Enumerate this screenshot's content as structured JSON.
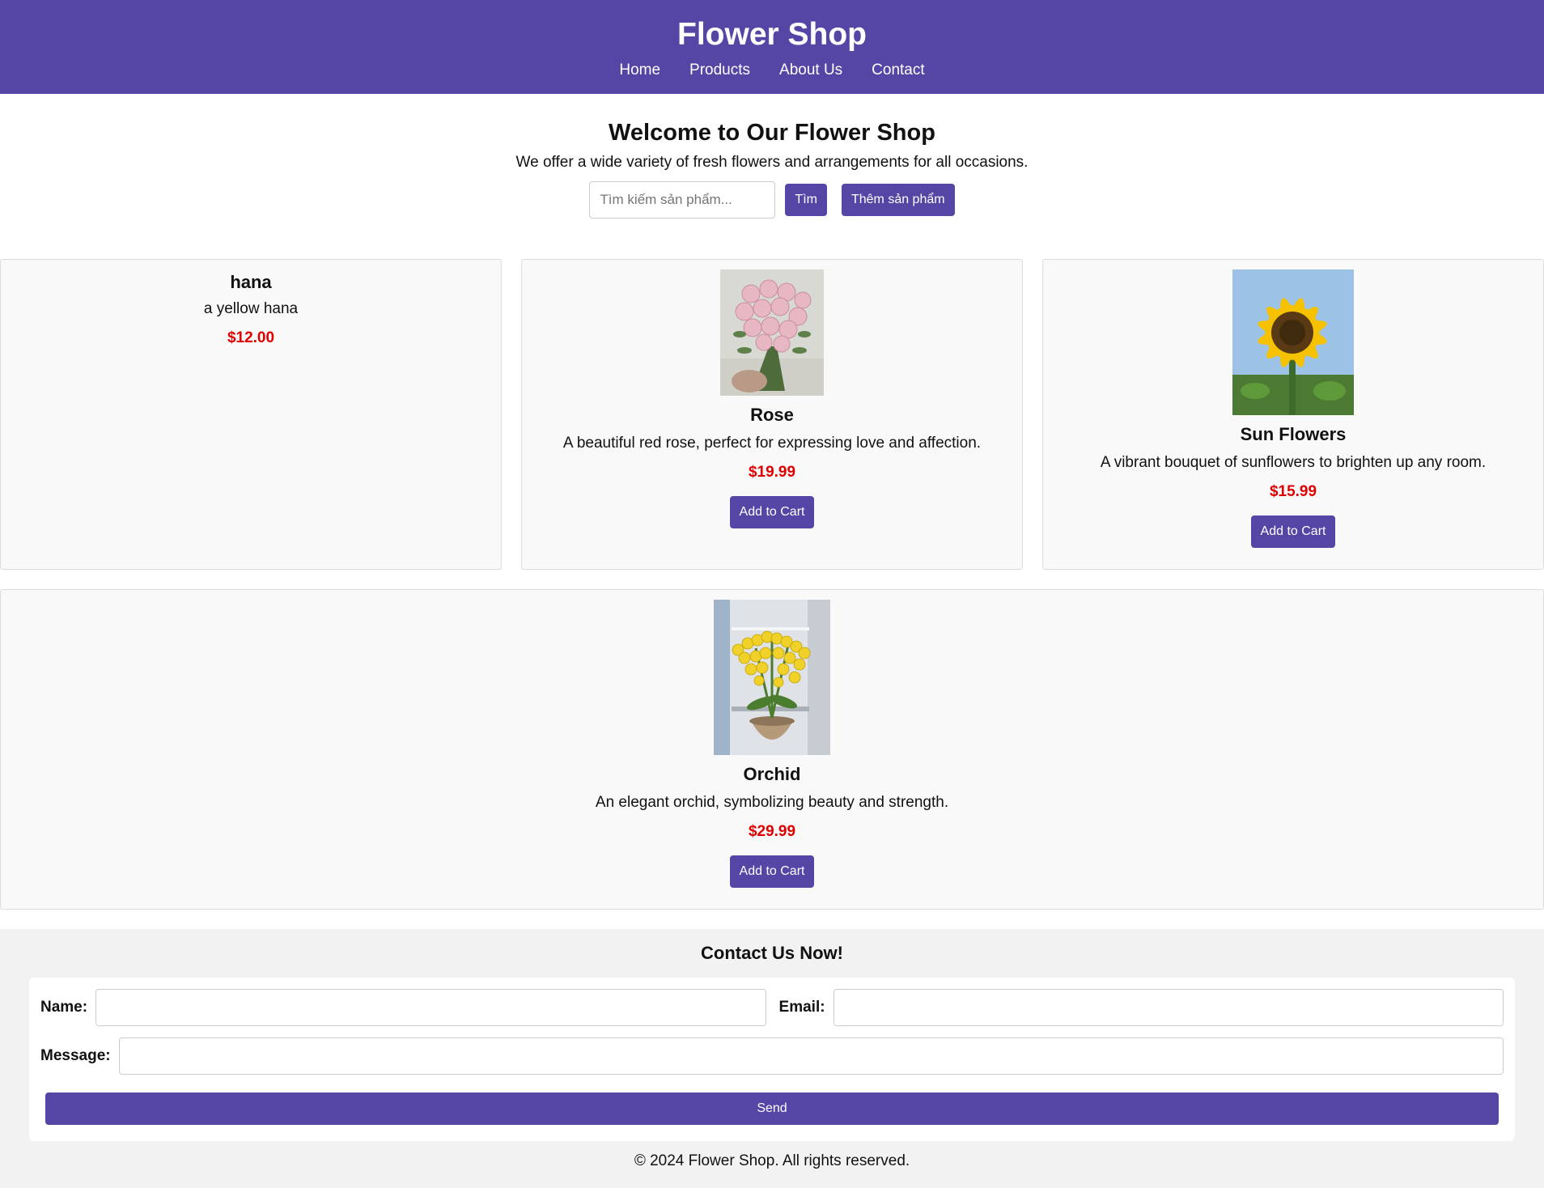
{
  "header": {
    "title": "Flower Shop",
    "nav": [
      "Home",
      "Products",
      "About Us",
      "Contact"
    ]
  },
  "hero": {
    "heading": "Welcome to Our Flower Shop",
    "subtitle": "We offer a wide variety of fresh flowers and arrangements for all occasions.",
    "search_placeholder": "Tìm kiếm sản phẩm...",
    "search_button": "Tìm",
    "add_product_button": "Thêm sản phẩm"
  },
  "products": [
    {
      "name": "hana",
      "description": "a yellow hana",
      "price": "$12.00"
    },
    {
      "name": "Rose",
      "description": "A beautiful red rose, perfect for expressing love and affection.",
      "price": "$19.99",
      "button": "Add to Cart"
    },
    {
      "name": "Sun Flowers",
      "description": "A vibrant bouquet of sunflowers to brighten up any room.",
      "price": "$15.99",
      "button": "Add to Cart"
    },
    {
      "name": "Orchid",
      "description": "An elegant orchid, symbolizing beauty and strength.",
      "price": "$29.99",
      "button": "Add to Cart"
    }
  ],
  "contact": {
    "heading": "Contact Us Now!",
    "name_label": "Name:",
    "email_label": "Email:",
    "message_label": "Message:",
    "send_button": "Send"
  },
  "footer": {
    "text": "© 2024 Flower Shop. All rights reserved."
  },
  "colors": {
    "primary": "#5546a6",
    "price": "#e00000",
    "card_bg": "#f9f9f9",
    "contact_bg": "#f2f2f2"
  }
}
